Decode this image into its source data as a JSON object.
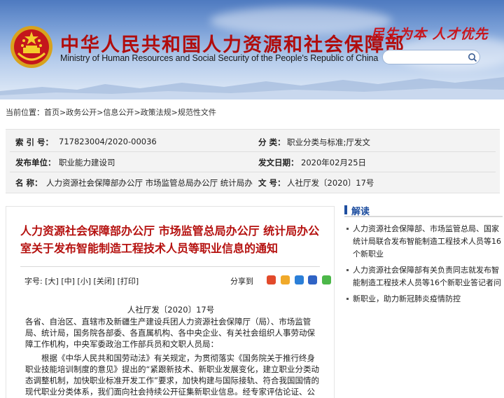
{
  "header": {
    "title_cn": "中华人民共和国人力资源和社会保障部",
    "title_en": "Ministry of Human Resources and Social Security of the People's Republic of China",
    "slogan": "民生为本 人才优先",
    "search_placeholder": ""
  },
  "breadcrumb": {
    "prefix": "当前位置：",
    "items": [
      "首页",
      "政务公开",
      "信息公开",
      "政策法规",
      "规范性文件"
    ],
    "separator": ">"
  },
  "info": {
    "index_label": "索 引 号：",
    "index_value": "717823004/2020-00036",
    "category_label": "分    类：",
    "category_value": "职业分类与标准;厅发文",
    "publisher_label": "发布单位：",
    "publisher_value": "职业能力建设司",
    "date_label": "发文日期：",
    "date_value": "2020年02月25日",
    "name_label": "名    称：",
    "name_value": "人力资源社会保障部办公厅 市场监管总局办公厅 统计局办",
    "docno_label": "文    号：",
    "docno_value": "人社厅发〔2020〕17号"
  },
  "article": {
    "title": "人力资源社会保障部办公厅 市场监管总局办公厅 统计局办公室关于发布智能制造工程技术人员等职业信息的通知",
    "font_size_label": "字号:",
    "font_options": [
      "[大]",
      "[中]",
      "[小]",
      "[关闭]",
      "[打印]"
    ],
    "share_label": "分享到",
    "doc_number": "人社厅发〔2020〕17号",
    "recipients": "各省、自治区、直辖市及新疆生产建设兵团人力资源社会保障厅（局）、市场监管局、统计局，国务院各部委、各直属机构、各中央企业、有关社会组织人事劳动保障工作机构，中央军委政治工作部兵员和文职人员局：",
    "paragraph1": "根据《中华人民共和国劳动法》有关规定，为贯彻落实《国务院关于推行终身职业技能培训制度的意见》提出的“紧跟新技术、新职业发展变化，建立职业分类动态调整机制，加快职业标准开发工作”要求，加快构建与国际接轨、符合我国国情的现代职业分类体系，我们面向社会持续公开征集新职业信息。经专家评估论证、公"
  },
  "sidebar": {
    "heading": "解读",
    "items": [
      "人力资源社会保障部、市场监管总局、国家统计局联合发布智能制造工程技术人员等16个新职业",
      "人力资源社会保障部有关负责同志就发布智能制造工程技术人员等16个新职业答记者问",
      "新职业，助力新冠肺炎疫情防控"
    ]
  },
  "colors": {
    "title_red": "#b5110f",
    "heading_blue": "#1f4fa0",
    "banner_top": "#4e7ac0"
  }
}
